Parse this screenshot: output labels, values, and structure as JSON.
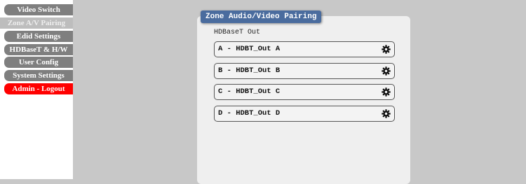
{
  "sidebar": {
    "items": [
      {
        "label": "Video Switch"
      },
      {
        "label": "Zone A/V Pairing"
      },
      {
        "label": "Edid Settings"
      },
      {
        "label": "HDBaseT & H/W"
      },
      {
        "label": "User Config"
      },
      {
        "label": "System Settings"
      },
      {
        "label": "Admin - Logout"
      }
    ]
  },
  "panel": {
    "title": "Zone Audio/Video Pairing",
    "group_label": "HDBaseT Out",
    "outputs": [
      {
        "label": "A - HDBT_Out A",
        "icon": "gear-icon"
      },
      {
        "label": "B - HDBT_Out B",
        "icon": "gear-icon"
      },
      {
        "label": "C - HDBT_Out C",
        "icon": "gear-icon"
      },
      {
        "label": "D - HDBT_Out D",
        "icon": "gear-icon"
      }
    ]
  },
  "colors": {
    "nav_default": "#7f7f7f",
    "nav_active": "#bdbdbd",
    "nav_logout": "#ff0000",
    "title_bar": "#4a6c9e",
    "background": "#c8c8c8"
  }
}
